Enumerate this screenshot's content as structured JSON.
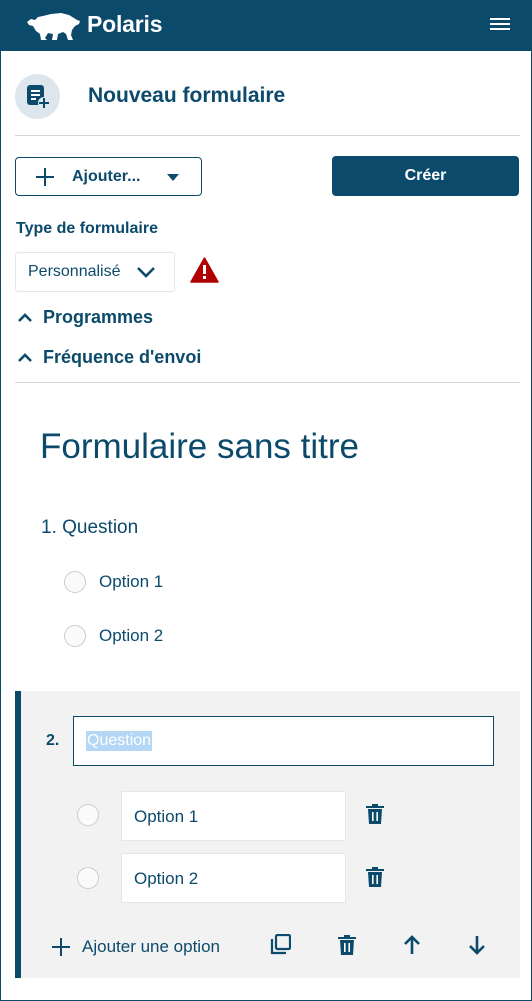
{
  "header": {
    "app_name": "Polaris",
    "logo_icon": "polar-bear-logo",
    "menu_icon": "hamburger-menu-icon"
  },
  "page": {
    "title": "Nouveau formulaire",
    "icon": "form-add-icon"
  },
  "toolbar": {
    "add_label": "Ajouter...",
    "create_label": "Créer"
  },
  "form_type": {
    "label": "Type de formulaire",
    "selected": "Personnalisé",
    "warning_icon": "warning-triangle-icon",
    "warning_color": "#b00000"
  },
  "sections": [
    {
      "label": "Programmes",
      "expanded": true
    },
    {
      "label": "Fréquence d'envoi",
      "expanded": true
    }
  ],
  "preview": {
    "title": "Formulaire sans titre",
    "question_label": "1. Question",
    "options": [
      "Option 1",
      "Option 2"
    ]
  },
  "editor": {
    "question_number": "2.",
    "question_value": "Question",
    "options": [
      "Option 1",
      "Option 2"
    ],
    "add_option_label": "Ajouter une option"
  },
  "colors": {
    "brand": "#0b4a6b",
    "editor_background": "#f2f2f2",
    "divider": "#d3d8dc"
  }
}
